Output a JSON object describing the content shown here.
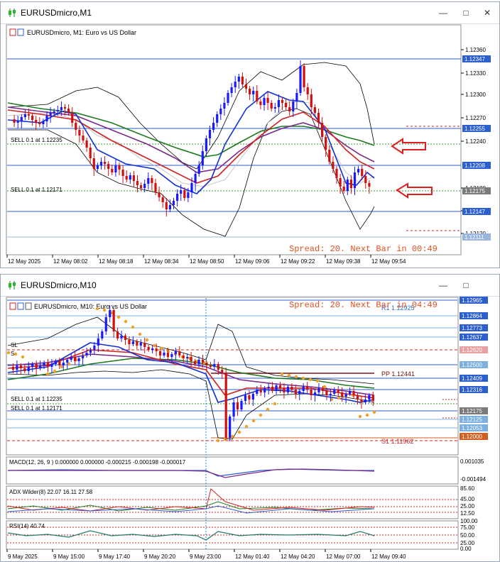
{
  "top_window": {
    "title": "EURUSDmicro,M1",
    "chart_header": "EURUSDmicro, M1:  Euro vs US Dollar",
    "status_text": "Spread: 20. Next Bar in 00:49",
    "order_labels": [
      "SELL 0.1 at 1.12235",
      "SELL 0.1 at 1.12171"
    ],
    "price_ticks": [
      "1.12360",
      "1.12330",
      "1.12300",
      "1.12270",
      "1.12240",
      "1.12180",
      "1.12150",
      "1.12120"
    ],
    "price_tags": [
      "1.12347",
      "1.12255",
      "1.12208",
      "1.12175",
      "1.12147",
      "1.12111"
    ],
    "time_labels": [
      "12 May 2025",
      "12 May 08:02",
      "12 May 08:18",
      "12 May 08:34",
      "12 May 08:50",
      "12 May 09:06",
      "12 May 09:22",
      "12 May 09:38",
      "12 May 09:54"
    ]
  },
  "bottom_window": {
    "title": "EURUSDmicro,M10",
    "chart_header": "EURUSDmicro, M10:  Euro vs US Dollar",
    "status_text": "Spread: 20. Next Bar in 04:49",
    "sl_label": "SL",
    "s_label": "S",
    "r1_label": "R1 1.12925",
    "pp_label": "PP 1.12441",
    "s1_label": "S1 1.11962",
    "order_labels": [
      "SELL 0.1 at 1.12235",
      "SELL 0.1 at 1.12171"
    ],
    "price_tags": [
      "1.12965",
      "1.12864",
      "1.12773",
      "1.12637",
      "1.12620",
      "1.12500",
      "1.12409",
      "1.12316",
      "1.12175",
      "1.12125",
      "1.12053",
      "1.12000"
    ],
    "macd_label": "MACD(12, 26, 9 ) 0.000000 0.000000 -0.000215 -0.000198 -0.000017",
    "macd_ticks": [
      "0.001035",
      "-0.001494"
    ],
    "adx_label": "ADX Wilder(8) 22.07 16.11 27.58",
    "adx_ticks": [
      "85.60",
      "45.00",
      "25.00",
      "12.50"
    ],
    "rsi_label": "RSI(14) 40.74",
    "rsi_ticks": [
      "100.00",
      "75.00",
      "50.00",
      "25.00",
      "0.00"
    ],
    "time_labels": [
      "9 May 2025",
      "9 May 15:00",
      "9 May 17:40",
      "9 May 20:20",
      "9 May 23:00",
      "12 May 01:40",
      "12 May 04:20",
      "12 May 07:00",
      "12 May 09:40"
    ]
  },
  "colors": {
    "candle_up": "#1a1aff",
    "candle_down": "#d01010",
    "ma_green": "#1e7a1e",
    "ma_purple": "#7a2a8a",
    "ma_red": "#d02020",
    "ma_blue": "#1030d0",
    "sar": "#f2a020",
    "arrow": "#e02020",
    "tag_blue": "#2b5ecf",
    "tag_red": "#e8a0a0"
  }
}
